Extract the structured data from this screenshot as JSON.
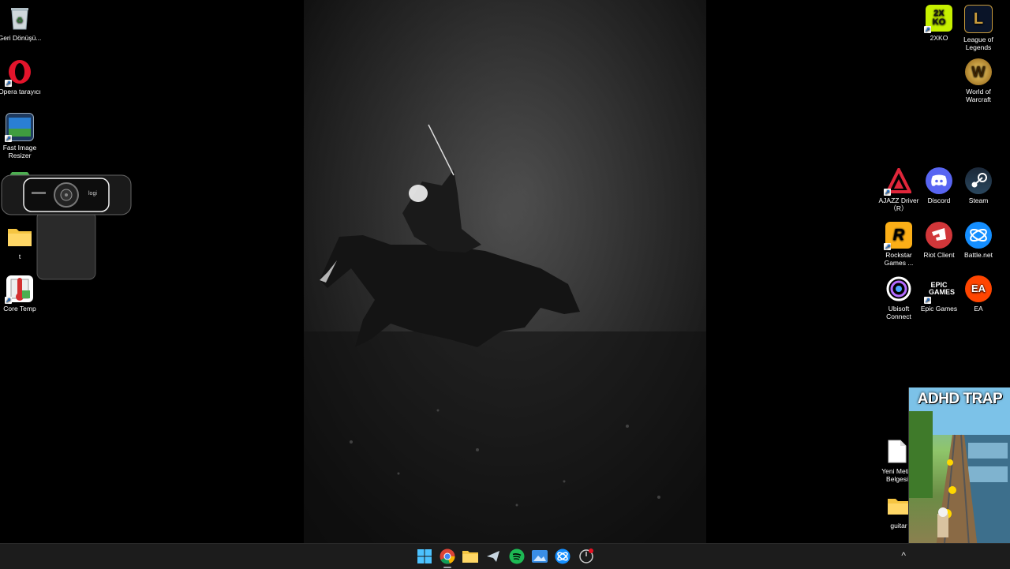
{
  "desktop": {
    "left_icons": [
      {
        "label": "Geri Dönüşü...",
        "icon": "recycle-bin-icon"
      },
      {
        "label": "Opera tarayıcı",
        "icon": "opera-icon"
      },
      {
        "label": "Fast Image Resizer",
        "icon": "image-resizer-icon"
      },
      {
        "label": "t",
        "icon": "folder-icon"
      },
      {
        "label": "Core Temp",
        "icon": "core-temp-icon"
      }
    ],
    "right_icons": [
      {
        "label": "2XKO",
        "icon": "2xko-icon",
        "glyph": "2X KO"
      },
      {
        "label": "League of Legends",
        "icon": "league-icon",
        "glyph": "L"
      },
      {
        "label": "World of Warcraft",
        "icon": "wow-icon",
        "glyph": "W"
      },
      {
        "label": "AJAZZ Driver（R）",
        "icon": "ajazz-icon",
        "glyph": "A"
      },
      {
        "label": "Discord",
        "icon": "discord-icon",
        "glyph": ""
      },
      {
        "label": "Steam",
        "icon": "steam-icon",
        "glyph": ""
      },
      {
        "label": "Rockstar Games ...",
        "icon": "rockstar-icon",
        "glyph": "R"
      },
      {
        "label": "Riot Client",
        "icon": "riot-icon",
        "glyph": ""
      },
      {
        "label": "Battle.net",
        "icon": "battlenet-icon",
        "glyph": ""
      },
      {
        "label": "Ubisoft Connect",
        "icon": "ubisoft-icon",
        "glyph": ""
      },
      {
        "label": "Epic Games",
        "icon": "epic-icon",
        "glyph": "EPIC GAMES"
      },
      {
        "label": "EA",
        "icon": "ea-icon",
        "glyph": "EA"
      },
      {
        "label": "Yeni Metin Belgesi",
        "icon": "text-document-icon",
        "glyph": ""
      },
      {
        "label": "guitar",
        "icon": "folder-icon",
        "glyph": ""
      }
    ]
  },
  "webcam": {
    "brand": "logi"
  },
  "game_overlay": {
    "title": "ADHD TRAP"
  },
  "taskbar": {
    "items": [
      {
        "name": "start-icon",
        "active": false
      },
      {
        "name": "chrome-icon",
        "active": true
      },
      {
        "name": "file-explorer-icon",
        "active": false
      },
      {
        "name": "steam-icon",
        "active": false
      },
      {
        "name": "spotify-icon",
        "active": false
      },
      {
        "name": "photos-icon",
        "active": false
      },
      {
        "name": "battlenet-icon",
        "active": false
      },
      {
        "name": "riot-client-icon",
        "active": false
      }
    ],
    "tray_chevron": "^"
  },
  "colors": {
    "taskbar_bg": "#1c1c1c",
    "opera_red": "#e3142b",
    "discord": "#5865f2",
    "steam": "#1b2838",
    "battlenet": "#148eff",
    "ea": "#ff4500",
    "riot": "#d13639"
  }
}
